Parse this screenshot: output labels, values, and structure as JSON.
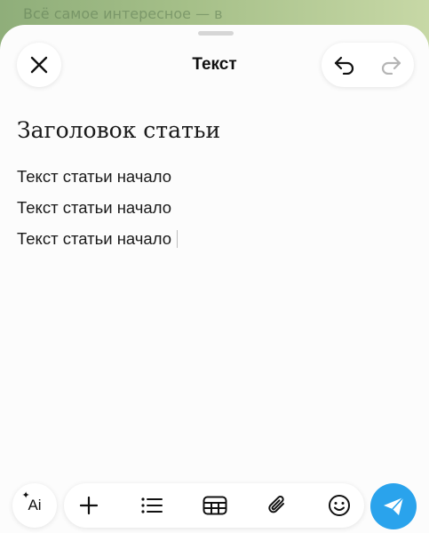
{
  "background": {
    "text": "Всё самое интересное — в",
    "colors": {
      "chat_bg": "#a6c089"
    }
  },
  "header": {
    "title": "Текст",
    "close_icon": "close-icon",
    "undo_icon": "undo-icon",
    "redo_icon": "redo-icon"
  },
  "editor": {
    "heading": "Заголовок статьи",
    "lines": [
      "Текст статьи начало",
      "Текст статьи начало",
      "Текст статьи начало"
    ]
  },
  "toolbar": {
    "ai_label": "Ai",
    "items": [
      "add-icon",
      "list-icon",
      "table-icon",
      "attach-icon",
      "emoji-icon"
    ],
    "send_icon": "send-icon"
  },
  "colors": {
    "accent": "#2aa3ec",
    "sheet": "#fcfcfc",
    "text": "#1a1a1a"
  }
}
